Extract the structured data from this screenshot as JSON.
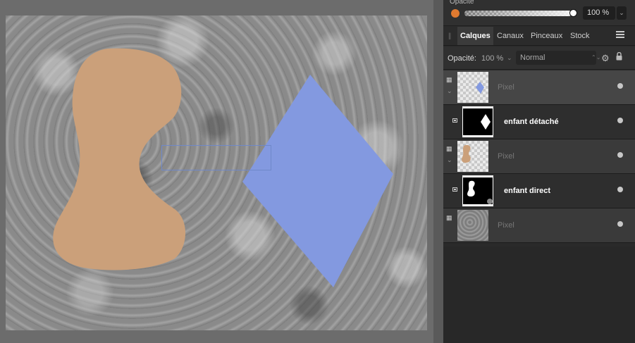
{
  "top_bar": {
    "opacity_label": "Opacité",
    "opacity_value": "100 %",
    "opacity_fraction": 1.0,
    "color": "#e07a30",
    "chevron": "⌄"
  },
  "tabs": [
    {
      "label": "Calques",
      "active": true
    },
    {
      "label": "Canaux",
      "active": false
    },
    {
      "label": "Pinceaux",
      "active": false
    },
    {
      "label": "Stock",
      "active": false
    }
  ],
  "layer_toolbar": {
    "opacity_label": "Opacité:",
    "opacity_value": "100 %",
    "blend_mode": "Normal"
  },
  "layers": [
    {
      "name": "Pixel",
      "kind": "parent",
      "thumb": "blue-diamond"
    },
    {
      "name": "enfant détaché",
      "kind": "child",
      "thumb": "white-diamond-mask"
    },
    {
      "name": "Pixel",
      "kind": "parent",
      "thumb": "orange-shape"
    },
    {
      "name": "enfant direct",
      "kind": "child",
      "thumb": "white-shape-mask"
    },
    {
      "name": "Pixel",
      "kind": "parent",
      "thumb": "grey-noise"
    }
  ],
  "canvas_colors": {
    "shape_fill": "#cba07a",
    "diamond_fill": "#8399e0",
    "selection": "#6f88c9"
  },
  "icons": {
    "gear": "gear-icon",
    "lock": "lock-icon",
    "menu": "hamburger-menu-icon"
  }
}
